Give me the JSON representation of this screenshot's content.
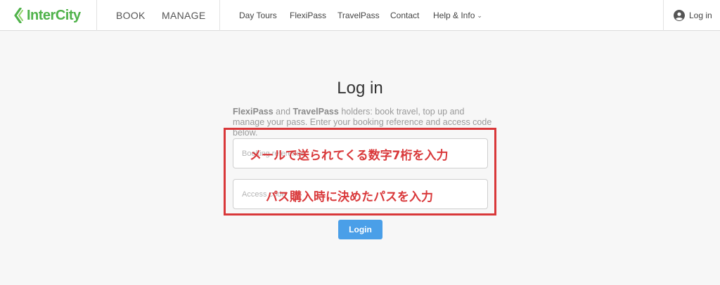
{
  "header": {
    "logo_text": "InterCity",
    "nav_main": [
      "BOOK",
      "MANAGE"
    ],
    "nav_secondary": [
      "Day Tours",
      "FlexiPass",
      "TravelPass",
      "Contact",
      "Help & Info"
    ],
    "help_chevron": "⌄",
    "login_label": "Log in",
    "brand_color": "#4fb24a"
  },
  "main": {
    "title": "Log in",
    "intro": {
      "flexipass": "FlexiPass",
      "and": " and ",
      "travelpass": "TravelPass",
      "rest": " holders: book travel, top up and manage your pass. Enter your booking reference and access code below."
    },
    "booking_ref_placeholder": "Booking reference",
    "access_code_placeholder": "Access code",
    "login_button": "Login",
    "button_color": "#4a9fe8"
  },
  "annotations": {
    "booking_ref_note": "メールで送られてくる数字7桁を入力",
    "access_code_note": "パス購入時に決めたパスを入力",
    "color": "#d9383a"
  }
}
